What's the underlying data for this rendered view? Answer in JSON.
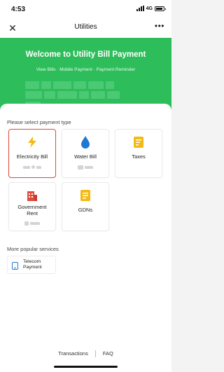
{
  "status_bar": {
    "time": "4:53",
    "network": "4G"
  },
  "nav": {
    "title": "Utilities"
  },
  "hero": {
    "title": "Welcome to Utility Bill Payment",
    "subtitle": "View Bills · Mobile Payment · Payment Reminder"
  },
  "sections": {
    "payment_type_label": "Please select payment type",
    "popular_label": "More popular services"
  },
  "payment_types": [
    {
      "label": "Electricity Bill",
      "icon": "lightning-icon",
      "color": "#f5b914",
      "selected": true
    },
    {
      "label": "Water Bill",
      "icon": "water-drop-icon",
      "color": "#1f78d1",
      "selected": false
    },
    {
      "label": "Taxes",
      "icon": "tax-document-icon",
      "color": "#f5b914",
      "selected": false
    },
    {
      "label": "Government Rent",
      "icon": "building-icon",
      "color": "#e14b3b",
      "selected": false
    },
    {
      "label": "GDNs",
      "icon": "receipt-icon",
      "color": "#f5b914",
      "selected": false
    }
  ],
  "popular_services": [
    {
      "label": "Telecom Payment",
      "icon": "phone-icon",
      "color": "#1f78d1"
    }
  ],
  "footer": {
    "transactions": "Transactions",
    "faq": "FAQ"
  },
  "colors": {
    "brand_green": "#2ebd5b",
    "selected_border": "#e14b3b"
  }
}
